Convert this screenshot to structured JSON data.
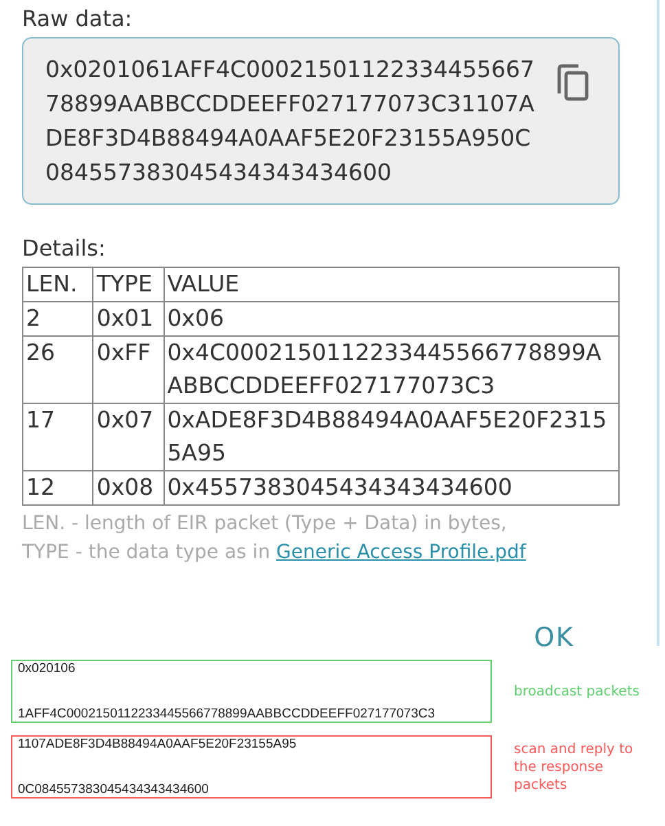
{
  "raw_data": {
    "label": "Raw data:",
    "value": "0x0201061AFF4C0002150112233445566778899AABBCCDDEEFF027177073C31107ADE8F3D4B88494A0AAF5E20F23155A950C084557383045434343434600"
  },
  "details": {
    "label": "Details:",
    "columns": [
      "LEN.",
      "TYPE",
      "VALUE"
    ],
    "rows": [
      {
        "len": "2",
        "type": "0x01",
        "value": "0x06"
      },
      {
        "len": "26",
        "type": "0xFF",
        "value": "0x4C0002150112233445566778899AABBCCDDEEFF027177073C3"
      },
      {
        "len": "17",
        "type": "0x07",
        "value": "0xADE8F3D4B88494A0AAF5E20F23155A95"
      },
      {
        "len": "12",
        "type": "0x08",
        "value": "0x4557383045434343434600"
      }
    ]
  },
  "legend": {
    "line_1": "LEN. - length of EIR packet (Type + Data) in bytes,",
    "line_2": "TYPE - the data type as in ",
    "link": "Generic Access Profile.pdf"
  },
  "ok_button": "OK",
  "annotations": [
    {
      "lines": [
        "0x020106",
        "1AFF4C0002150112233445566778899AABBCCDDEEFF027177073C3"
      ],
      "label": "broadcast packets",
      "color": "#5fcf6f"
    },
    {
      "lines": [
        "1107ADE8F3D4B88494A0AAF5E20F23155A95",
        "0C084557383045434343434600"
      ],
      "label": "scan and reply to the response packets",
      "color": "#ff5a5a"
    }
  ]
}
